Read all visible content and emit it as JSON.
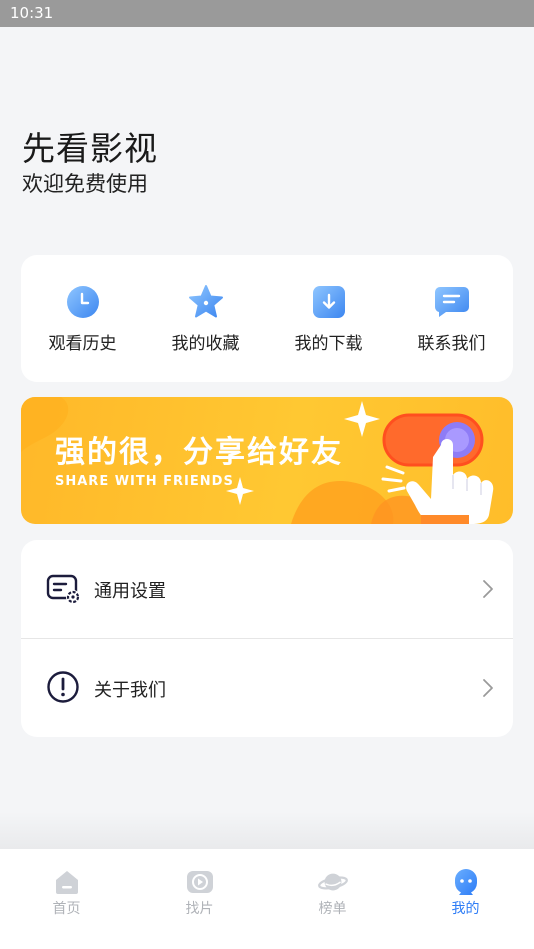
{
  "status_bar": {
    "time": "10:31"
  },
  "header": {
    "title": "先看影视",
    "subtitle": "欢迎免费使用"
  },
  "quick_actions": [
    {
      "label": "观看历史",
      "icon": "clock-icon"
    },
    {
      "label": "我的收藏",
      "icon": "star-icon"
    },
    {
      "label": "我的下载",
      "icon": "download-icon"
    },
    {
      "label": "联系我们",
      "icon": "chat-icon"
    }
  ],
  "banner": {
    "title": "强的很，分享给好友",
    "subtitle": "SHARE WITH FRIENDS"
  },
  "settings": [
    {
      "label": "通用设置",
      "icon": "settings-icon"
    },
    {
      "label": "关于我们",
      "icon": "info-icon"
    }
  ],
  "tabs": [
    {
      "label": "首页",
      "icon": "home-icon",
      "active": false
    },
    {
      "label": "找片",
      "icon": "play-icon",
      "active": false
    },
    {
      "label": "榜单",
      "icon": "planet-icon",
      "active": false
    },
    {
      "label": "我的",
      "icon": "profile-icon",
      "active": true
    }
  ],
  "colors": {
    "accent": "#2d7cf6",
    "banner": "#ffc832",
    "background": "#f4f5f7"
  }
}
